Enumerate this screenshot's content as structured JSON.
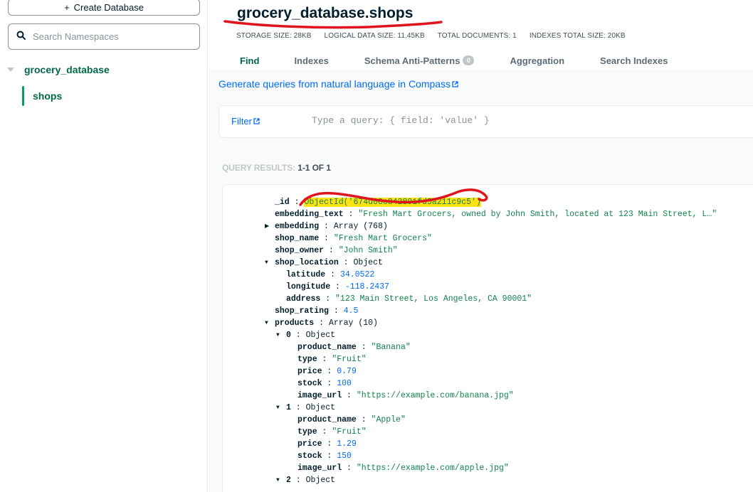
{
  "sidebar": {
    "create_database_label": "Create Database",
    "search_placeholder": "Search Namespaces",
    "database_name": "grocery_database",
    "collection_name": "shops"
  },
  "header": {
    "namespace": "grocery_database.shops",
    "stats": [
      "STORAGE SIZE: 28KB",
      "LOGICAL DATA SIZE: 11.45KB",
      "TOTAL DOCUMENTS: 1",
      "INDEXES TOTAL SIZE: 20KB"
    ],
    "tabs": [
      {
        "label": "Find",
        "active": true
      },
      {
        "label": "Indexes"
      },
      {
        "label": "Schema Anti-Patterns",
        "badge": "0"
      },
      {
        "label": "Aggregation"
      },
      {
        "label": "Search Indexes"
      }
    ]
  },
  "main": {
    "generate_link": "Generate queries from natural language in Compass",
    "filter_label": "Filter",
    "query_placeholder": "Type a query: { field: 'value' }",
    "results_label": "QUERY RESULTS:",
    "results_count": "1-1 OF 1"
  },
  "document": {
    "lines": [
      {
        "indent": 0,
        "key": "_id",
        "value": "ObjectId('674d08c342891fd5a211c9c5')",
        "kind": "oid"
      },
      {
        "indent": 0,
        "key": "embedding_text",
        "value": "\"Fresh Mart Grocers, owned by John Smith, located at 123 Main Street, L…\"",
        "kind": "str"
      },
      {
        "indent": 0,
        "key": "embedding",
        "value": "Array (768)",
        "kind": "type",
        "caret": "right"
      },
      {
        "indent": 0,
        "key": "shop_name",
        "value": "\"Fresh Mart Grocers\"",
        "kind": "str"
      },
      {
        "indent": 0,
        "key": "shop_owner",
        "value": "\"John Smith\"",
        "kind": "str"
      },
      {
        "indent": 0,
        "key": "shop_location",
        "value": "Object",
        "kind": "type",
        "caret": "down"
      },
      {
        "indent": 1,
        "key": "latitude",
        "value": "34.0522",
        "kind": "num"
      },
      {
        "indent": 1,
        "key": "longitude",
        "value": "-118.2437",
        "kind": "num"
      },
      {
        "indent": 1,
        "key": "address",
        "value": "\"123 Main Street, Los Angeles, CA 90001\"",
        "kind": "str"
      },
      {
        "indent": 0,
        "key": "shop_rating",
        "value": "4.5",
        "kind": "num"
      },
      {
        "indent": 0,
        "key": "products",
        "value": "Array (10)",
        "kind": "type",
        "caret": "down"
      },
      {
        "indent": 1,
        "key": "0",
        "value": "Object",
        "kind": "type",
        "caret": "down"
      },
      {
        "indent": 2,
        "key": "product_name",
        "value": "\"Banana\"",
        "kind": "str"
      },
      {
        "indent": 2,
        "key": "type",
        "value": "\"Fruit\"",
        "kind": "str"
      },
      {
        "indent": 2,
        "key": "price",
        "value": "0.79",
        "kind": "num"
      },
      {
        "indent": 2,
        "key": "stock",
        "value": "100",
        "kind": "num"
      },
      {
        "indent": 2,
        "key": "image_url",
        "value": "\"https://example.com/banana.jpg\"",
        "kind": "str"
      },
      {
        "indent": 1,
        "key": "1",
        "value": "Object",
        "kind": "type",
        "caret": "down"
      },
      {
        "indent": 2,
        "key": "product_name",
        "value": "\"Apple\"",
        "kind": "str"
      },
      {
        "indent": 2,
        "key": "type",
        "value": "\"Fruit\"",
        "kind": "str"
      },
      {
        "indent": 2,
        "key": "price",
        "value": "1.29",
        "kind": "num"
      },
      {
        "indent": 2,
        "key": "stock",
        "value": "150",
        "kind": "num"
      },
      {
        "indent": 2,
        "key": "image_url",
        "value": "\"https://example.com/apple.jpg\"",
        "kind": "str"
      },
      {
        "indent": 1,
        "key": "2",
        "value": "Object",
        "kind": "type",
        "caret": "down"
      }
    ]
  },
  "icons": {
    "search": "search-icon",
    "external_link": "external-link-icon",
    "plus": "plus-icon"
  },
  "colors": {
    "accent_green": "#00684a",
    "link_blue": "#016bf8",
    "string_green": "#12824d",
    "highlight_yellow": "#ffe212",
    "annotation_red": "#e0141e"
  }
}
